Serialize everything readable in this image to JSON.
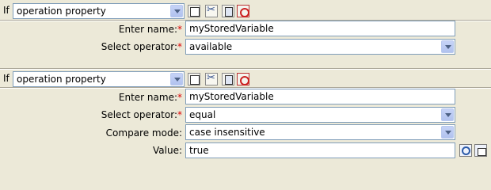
{
  "conditions": [
    {
      "if_label": "If",
      "type_select": "operation property",
      "fields": [
        {
          "label": "Enter name:",
          "required": "*",
          "value": "myStoredVariable"
        },
        {
          "label": "Select operator:",
          "required": "*",
          "value": "available"
        }
      ]
    },
    {
      "if_label": "If",
      "type_select": "operation property",
      "fields": [
        {
          "label": "Enter name:",
          "required": "*",
          "value": "myStoredVariable"
        },
        {
          "label": "Select operator:",
          "required": "*",
          "value": "equal"
        },
        {
          "label": "Compare mode:",
          "required": "",
          "value": "case insensitive"
        },
        {
          "label": "Value:",
          "required": "",
          "value": "true"
        }
      ]
    }
  ]
}
